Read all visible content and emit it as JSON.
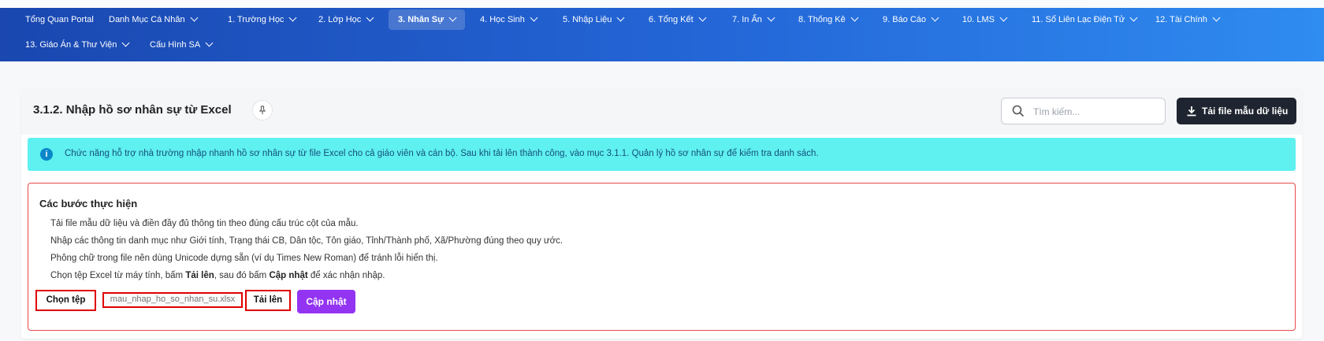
{
  "nav": {
    "items": [
      {
        "label": "Tổng Quan Portal",
        "dropdown": false
      },
      {
        "label": "Danh Mục Cá Nhân",
        "dropdown": true
      },
      {
        "label": "1. Trường Học",
        "dropdown": true
      },
      {
        "label": "2. Lớp Học",
        "dropdown": true
      },
      {
        "label": "3. Nhân Sự",
        "dropdown": true,
        "active": true
      },
      {
        "label": "4. Học Sinh",
        "dropdown": true
      },
      {
        "label": "5. Nhập Liệu",
        "dropdown": true
      },
      {
        "label": "6. Tổng Kết",
        "dropdown": true
      },
      {
        "label": "7. In Ấn",
        "dropdown": true
      },
      {
        "label": "8. Thống Kê",
        "dropdown": true
      },
      {
        "label": "9. Báo Cáo",
        "dropdown": true
      },
      {
        "label": "10. LMS",
        "dropdown": true
      },
      {
        "label": "11. Sổ Liên Lạc Điện Tử",
        "dropdown": true
      },
      {
        "label": "12. Tài Chính",
        "dropdown": true
      },
      {
        "label": "13. Giáo Án & Thư Viện",
        "dropdown": true
      },
      {
        "label": "Cấu Hình SA",
        "dropdown": true
      }
    ]
  },
  "header": {
    "title": "3.1.2. Nhập hồ sơ nhân sự từ Excel",
    "pin_icon": "pin-icon",
    "search_placeholder": "Tìm kiếm...",
    "download_label": "Tải file mẫu dữ liệu"
  },
  "info": {
    "icon": "info-icon",
    "message": "Chức năng hỗ trợ nhà trường nhập nhanh hồ sơ nhân sự từ file Excel cho cả giáo viên và cán bộ. Sau khi tải lên thành công, vào mục 3.1.1. Quản lý hồ sơ nhân sự để kiểm tra danh sách."
  },
  "steps": {
    "title": "Các bước thực hiện",
    "items": [
      "Tải file mẫu dữ liệu và điền đầy đủ thông tin theo đúng cấu trúc cột của mẫu.",
      "Nhập các thông tin danh mục như Giới tính, Trạng thái CB, Dân tộc, Tôn giáo, Tỉnh/Thành phố, Xã/Phường đúng theo quy ước.",
      "Phông chữ trong file nên dùng Unicode dựng sẵn (ví dụ Times New Roman) để tránh lỗi hiển thị."
    ],
    "last_step": {
      "part1": "Chọn tệp Excel từ máy tính, bấm ",
      "bold1": "Tải lên",
      "part2": ", sau đó bấm ",
      "bold2": "Cập nhật",
      "part3": " để xác nhận nhập."
    }
  },
  "actions": {
    "choose_label": "Chọn tệp",
    "file_name": "mau_nhap_ho_so_nhan_su.xlsx",
    "upload_label": "Tải lên",
    "update_label": "Cập nhật"
  },
  "colors": {
    "nav_start": "#1a47b0",
    "nav_end": "#2f8cf0",
    "info_bg": "#5ff0f0",
    "update_button": "#9334f2",
    "highlight_border": "#e00000",
    "download_button": "#1f2530"
  }
}
